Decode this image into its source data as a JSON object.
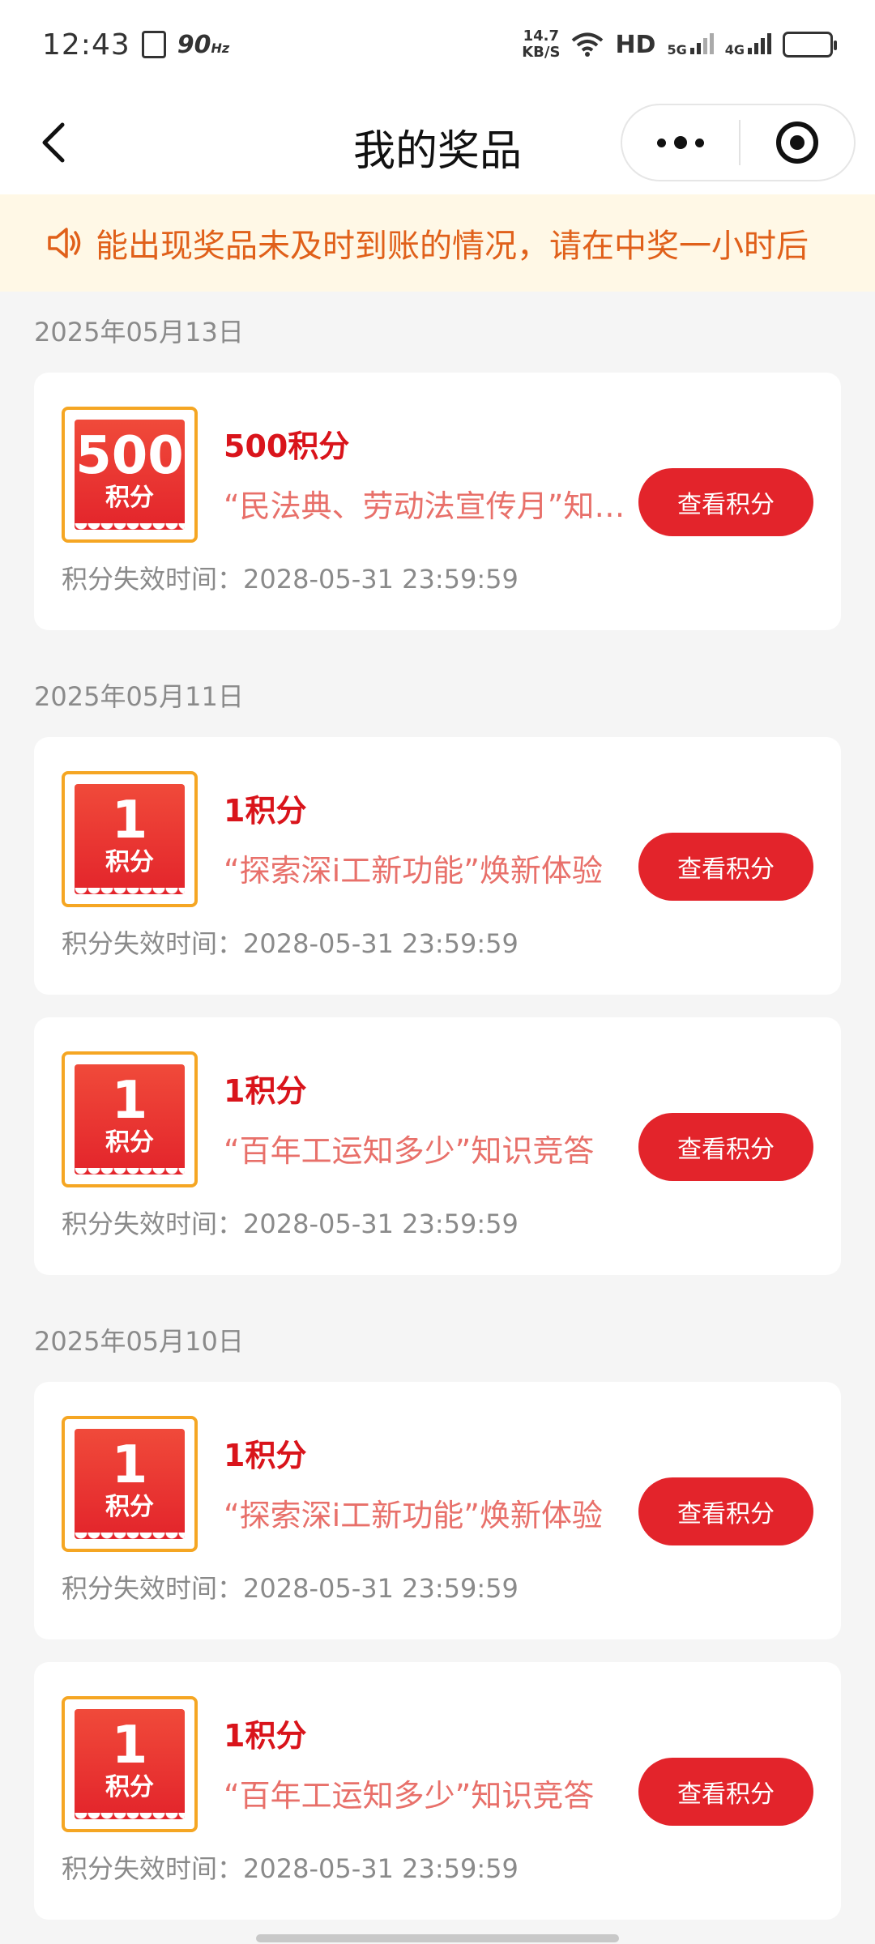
{
  "status_bar": {
    "time": "12:43",
    "refresh_rate": "90",
    "refresh_unit": "Hz",
    "net_speed_value": "14.7",
    "net_speed_unit": "KB/S",
    "hd_label": "HD",
    "sim1_type": "5G",
    "sim2_type": "4G"
  },
  "nav": {
    "title": "我的奖品"
  },
  "notice": {
    "text": "能出现奖品未及时到账的情况，请在中奖一小时后"
  },
  "groups": [
    {
      "date": "2025年05月13日",
      "items": [
        {
          "badge_value": "500",
          "badge_unit": "积分",
          "name": "500积分",
          "desc": "“民法典、劳动法宣传月”知识竞答",
          "button_label": "查看积分",
          "expire_text": "积分失效时间：2028-05-31 23:59:59"
        }
      ]
    },
    {
      "date": "2025年05月11日",
      "items": [
        {
          "badge_value": "1",
          "badge_unit": "积分",
          "name": "1积分",
          "desc": "“探索深i工新功能”焕新体验",
          "button_label": "查看积分",
          "expire_text": "积分失效时间：2028-05-31 23:59:59"
        },
        {
          "badge_value": "1",
          "badge_unit": "积分",
          "name": "1积分",
          "desc": "“百年工运知多少”知识竞答",
          "button_label": "查看积分",
          "expire_text": "积分失效时间：2028-05-31 23:59:59"
        }
      ]
    },
    {
      "date": "2025年05月10日",
      "items": [
        {
          "badge_value": "1",
          "badge_unit": "积分",
          "name": "1积分",
          "desc": "“探索深i工新功能”焕新体验",
          "button_label": "查看积分",
          "expire_text": "积分失效时间：2028-05-31 23:59:59"
        },
        {
          "badge_value": "1",
          "badge_unit": "积分",
          "name": "1积分",
          "desc": "“百年工运知多少”知识竞答",
          "button_label": "查看积分",
          "expire_text": "积分失效时间：2028-05-31 23:59:59"
        }
      ]
    }
  ],
  "colors": {
    "accent_red": "#e3242b",
    "badge_border": "#f5a623",
    "notice_bg": "#fff8e6",
    "notice_text": "#e0601a"
  }
}
